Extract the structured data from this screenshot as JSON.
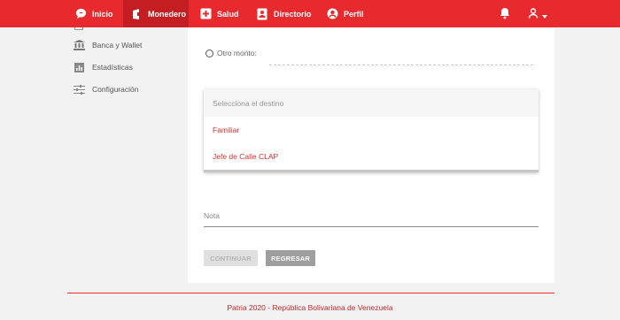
{
  "nav": {
    "items": [
      {
        "label": "Inicio",
        "icon": "chat-bubble-icon"
      },
      {
        "label": "Monedero",
        "icon": "wallet-icon",
        "active": true
      },
      {
        "label": "Salud",
        "icon": "medical-cross-icon"
      },
      {
        "label": "Directorio",
        "icon": "directory-icon"
      },
      {
        "label": "Perfil",
        "icon": "user-circle-icon"
      }
    ],
    "bar_color": "#e8292e",
    "active_color": "#c41e22"
  },
  "sidebar": {
    "items": [
      {
        "label": "Banca y Wallet",
        "icon": "bank-icon"
      },
      {
        "label": "Estadísticas",
        "icon": "bar-chart-icon"
      },
      {
        "label": "Configuración",
        "icon": "sliders-icon"
      }
    ]
  },
  "form": {
    "other_amount_label": "Otro monto:",
    "destination": {
      "placeholder": "Selecciona el destino",
      "options": [
        "Familiar",
        "Jefe de Calle CLAP"
      ]
    },
    "note_label": "Nota",
    "continue_label": "CONTINUAR",
    "back_label": "REGRESAR"
  },
  "footer": {
    "text": "Patria 2020 - República Bolivariana de Venezuela"
  }
}
